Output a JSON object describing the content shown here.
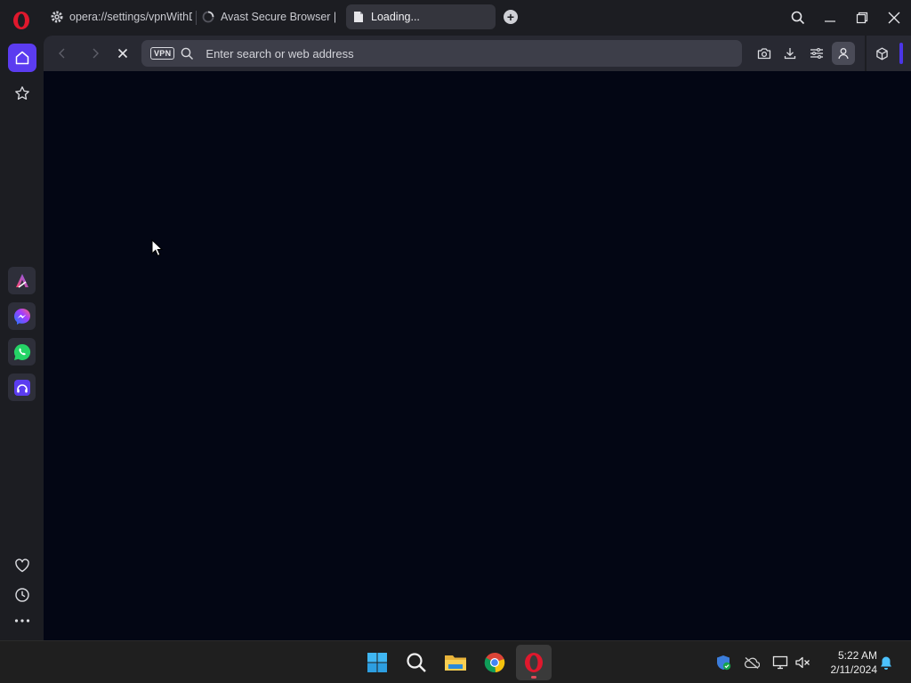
{
  "tabs": [
    {
      "title": "opera://settings/vpnWithDisclaimer",
      "icon": "settings-gear-icon",
      "active": false
    },
    {
      "title": "Avast Secure Browser | Privacy",
      "icon": "loading-spinner-icon",
      "active": false
    },
    {
      "title": "Loading...",
      "icon": "page-icon",
      "active": true
    }
  ],
  "new_tab_label": "+",
  "toolbar": {
    "vpn_label": "VPN",
    "address_placeholder": "Enter search or web address",
    "address_value": ""
  },
  "sidebar": {
    "items": [
      "home",
      "pinboards",
      "aria",
      "messenger",
      "whatsapp",
      "music-player"
    ],
    "bottom_items": [
      "favorites",
      "history",
      "more"
    ]
  },
  "taskbar": {
    "apps": [
      "windows-start",
      "search",
      "file-explorer",
      "chrome",
      "opera"
    ],
    "time": "5:22 AM",
    "date": "2/11/2024"
  },
  "colors": {
    "accent": "#5b3cf0",
    "content_bg": "#030614",
    "opera_red": "#e0182d"
  }
}
